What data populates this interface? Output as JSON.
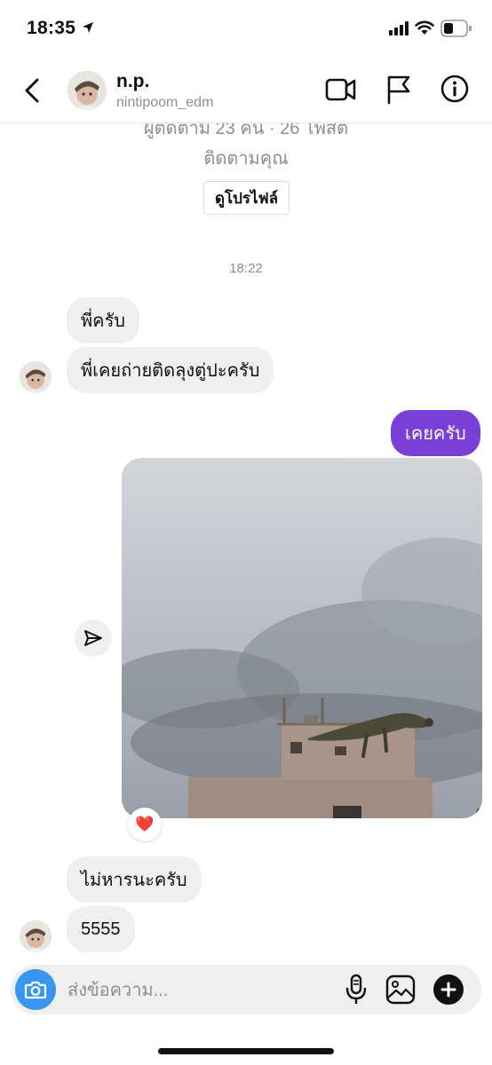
{
  "status_bar": {
    "time": "18:35",
    "icons": [
      "location-arrow-icon",
      "signal-icon",
      "wifi-icon",
      "battery-icon"
    ]
  },
  "header": {
    "name": "n.p.",
    "username": "nintipoom_edm",
    "icons": [
      "back-chevron-icon",
      "video-call-icon",
      "flag-icon",
      "info-icon"
    ]
  },
  "profile_summary": {
    "followers_line": "ผู้ติดตาม 23 คน · 26 โพสต์",
    "follows_you": "ติดตามคุณ",
    "view_profile_button": "ดูโปรไฟล์"
  },
  "timestamp": "18:22",
  "messages": [
    {
      "from": "them",
      "text": "พี่ครับ"
    },
    {
      "from": "them",
      "text": "พี่เคยถ่ายติดลุงตู่ปะครับ"
    },
    {
      "from": "me",
      "text": "เคยครับ"
    },
    {
      "from": "me",
      "type": "photo",
      "reaction": "❤️"
    },
    {
      "from": "them",
      "text": "ไม่หารนะครับ"
    },
    {
      "from": "them",
      "text": "5555"
    }
  ],
  "composer": {
    "placeholder": "ส่งข้อความ...",
    "icons": [
      "camera-icon",
      "microphone-icon",
      "gallery-icon",
      "plus-icon"
    ]
  },
  "colors": {
    "sent_bubble": "#7a3fd6",
    "received_bubble": "#efefef",
    "camera_button": "#3797f0",
    "reaction_heart": "#e0245e"
  }
}
